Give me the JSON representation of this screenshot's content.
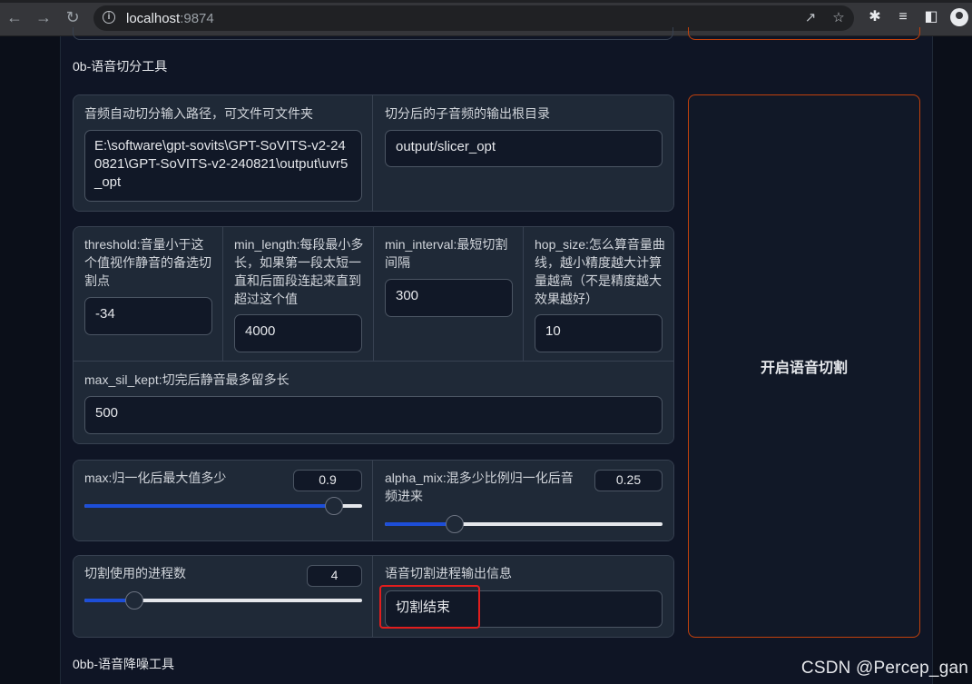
{
  "browser": {
    "url_host": "localhost",
    "url_port": ":9874"
  },
  "section_slicer": {
    "title": "0b-语音切分工具",
    "input_path": {
      "label": "音频自动切分输入路径，可文件可文件夹",
      "value": "E:\\software\\gpt-sovits\\GPT-SoVITS-v2-240821\\GPT-SoVITS-v2-240821\\output\\uvr5_opt"
    },
    "output_dir": {
      "label": "切分后的子音频的输出根目录",
      "value": "output/slicer_opt"
    },
    "threshold": {
      "label": "threshold:音量小于这个值视作静音的备选切割点",
      "value": "-34"
    },
    "min_length": {
      "label": "min_length:每段最小多长，如果第一段太短一直和后面段连起来直到超过这个值",
      "value": "4000"
    },
    "min_interval": {
      "label": "min_interval:最短切割间隔",
      "value": "300"
    },
    "hop_size": {
      "label": "hop_size:怎么算音量曲线，越小精度越大计算量越高（不是精度越大效果越好）",
      "value": "10"
    },
    "max_sil_kept": {
      "label": "max_sil_kept:切完后静音最多留多长",
      "value": "500"
    },
    "max_slider": {
      "label": "max:归一化后最大值多少",
      "value": "0.9",
      "fraction": 0.9
    },
    "alpha_slider": {
      "label": "alpha_mix:混多少比例归一化后音频进来",
      "value": "0.25",
      "fraction": 0.25
    },
    "process_slider": {
      "label": "切割使用的进程数",
      "value": "4",
      "fraction": 0.18
    },
    "output_info": {
      "label": "语音切割进程输出信息",
      "value": "切割结束"
    },
    "start_button": "开启语音切割"
  },
  "section_denoise": {
    "title": "0bb-语音降噪工具"
  },
  "watermark": "CSDN @Percep_gan",
  "colors": {
    "accent_orange": "#c2410c",
    "slider_fill": "#1d4ed8",
    "highlight_red": "#e11d1d"
  }
}
